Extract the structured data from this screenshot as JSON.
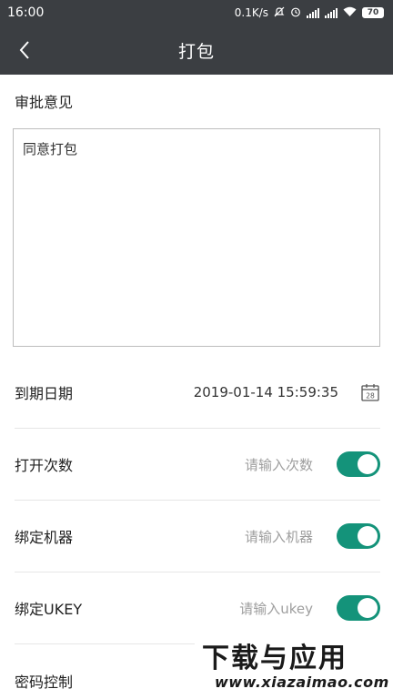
{
  "status_bar": {
    "time": "16:00",
    "network_speed": "0.1K/s",
    "battery": "70"
  },
  "app_bar": {
    "title": "打包"
  },
  "approval": {
    "label": "审批意见",
    "text": "同意打包"
  },
  "expiry": {
    "label": "到期日期",
    "value": "2019-01-14 15:59:35",
    "calendar_day": "28"
  },
  "open_count": {
    "label": "打开次数",
    "placeholder": "请输入次数",
    "enabled": true
  },
  "bind_machine": {
    "label": "绑定机器",
    "placeholder": "请输入机器",
    "enabled": true
  },
  "bind_ukey": {
    "label": "绑定UKEY",
    "placeholder": "请输入ukey",
    "enabled": true
  },
  "password_control": {
    "label": "密码控制"
  },
  "watermark": {
    "title": "下载与应用",
    "site": "www.xiazaimao.com"
  },
  "colors": {
    "bar": "#3b3e42",
    "toggle_on": "#14937a"
  }
}
